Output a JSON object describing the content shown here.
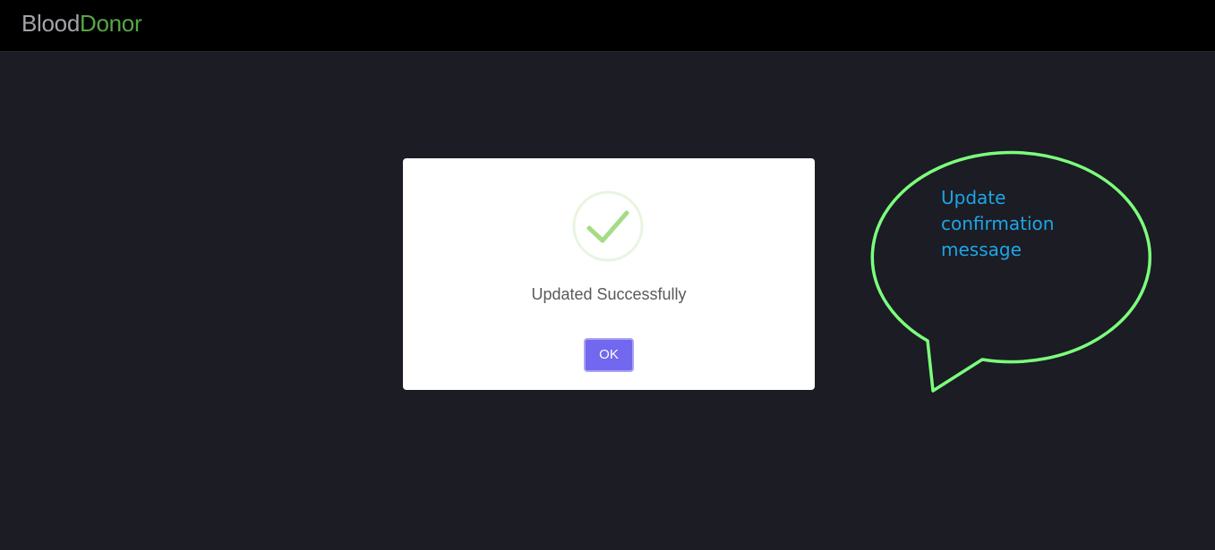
{
  "navbar": {
    "brand_part1": "Blood",
    "brand_part2": "Donor"
  },
  "modal": {
    "icon": "success-check-icon",
    "title": "Updated Successfully",
    "ok_label": "OK"
  },
  "annotation": {
    "lines": [
      "Update",
      "confirmation",
      "message"
    ]
  },
  "colors": {
    "background": "#1b1c24",
    "navbar": "#000000",
    "brand_donor": "#59a545",
    "button": "#7267ef",
    "check": "#a5dc86",
    "callout_outline": "#7cff7c",
    "callout_text": "#1fa5e6"
  }
}
